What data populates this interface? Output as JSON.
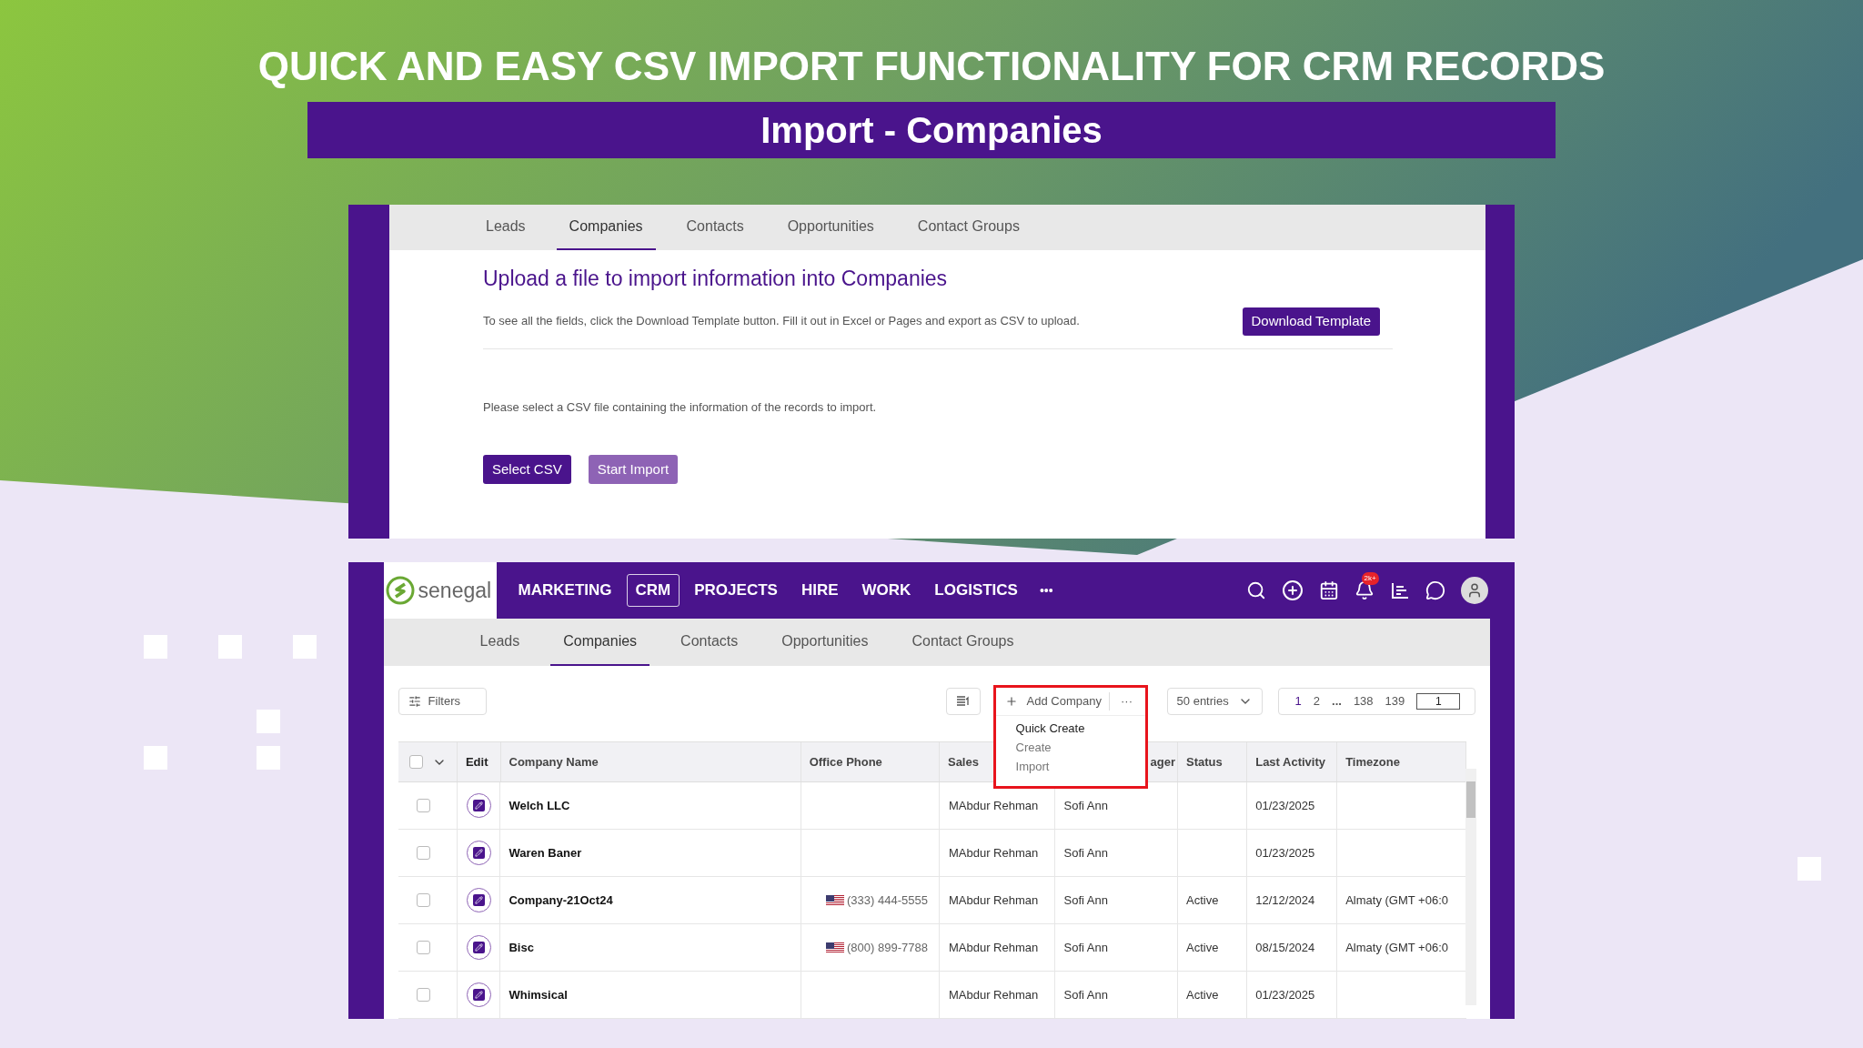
{
  "headline": "QUICK AND EASY CSV IMPORT FUNCTIONALITY FOR CRM RECORDS",
  "banner_title": "Import - Companies",
  "import_panel": {
    "tabs": [
      {
        "label": "Leads",
        "selected": false
      },
      {
        "label": "Companies",
        "selected": true
      },
      {
        "label": "Contacts",
        "selected": false
      },
      {
        "label": "Opportunities",
        "selected": false
      },
      {
        "label": "Contact Groups",
        "selected": false
      }
    ],
    "title": "Upload a file to import information into Companies",
    "instructions": "To see all the fields, click the Download Template button. Fill it out in Excel or Pages and export as CSV to upload.",
    "download_button": "Download Template",
    "select_prompt": "Please select a CSV file containing the information of the records to import.",
    "buttons": [
      {
        "label": "Select CSV",
        "disabled": false
      },
      {
        "label": "Start Import",
        "disabled": true
      }
    ]
  },
  "crm": {
    "logo_text": "senegal",
    "nav": [
      {
        "label": "MARKETING",
        "selected": false
      },
      {
        "label": "CRM",
        "selected": true
      },
      {
        "label": "PROJECTS",
        "selected": false
      },
      {
        "label": "HIRE",
        "selected": false
      },
      {
        "label": "WORK",
        "selected": false
      },
      {
        "label": "LOGISTICS",
        "selected": false
      }
    ],
    "nav_more": "•••",
    "notification_badge": "2k+",
    "tabs": [
      {
        "label": "Leads",
        "selected": false
      },
      {
        "label": "Companies",
        "selected": true
      },
      {
        "label": "Contacts",
        "selected": false
      },
      {
        "label": "Opportunities",
        "selected": false
      },
      {
        "label": "Contact Groups",
        "selected": false
      }
    ],
    "toolbar": {
      "filters": "Filters",
      "add_company": "Add Company",
      "more": "···",
      "entries": "50 entries",
      "pages": [
        {
          "label": "1",
          "selected": true
        },
        {
          "label": "2",
          "selected": false
        }
      ],
      "ellipsis": "...",
      "last_pages": [
        "138",
        "139"
      ],
      "page_input": "1"
    },
    "menu": [
      {
        "label": "Quick Create",
        "highlighted": true
      },
      {
        "label": "Create",
        "highlighted": false
      },
      {
        "label": "Import",
        "highlighted": false
      }
    ],
    "table": {
      "select_all_checked": false,
      "columns": [
        "Edit",
        "Company Name",
        "Office Phone",
        "Sales",
        "ager",
        "Status",
        "Last Activity",
        "Timezone"
      ],
      "rows": [
        {
          "checked": false,
          "company": "Welch LLC",
          "phone": "",
          "sales": "MAbdur Rehman",
          "manager": "Sofi Ann",
          "status": "",
          "last_activity": "01/23/2025",
          "timezone": ""
        },
        {
          "checked": false,
          "company": "Waren Baner",
          "phone": "",
          "sales": "MAbdur Rehman",
          "manager": "Sofi Ann",
          "status": "",
          "last_activity": "01/23/2025",
          "timezone": ""
        },
        {
          "checked": false,
          "company": "Company-21Oct24",
          "phone": "(333) 444-5555",
          "sales": "MAbdur Rehman",
          "manager": "Sofi Ann",
          "status": "Active",
          "last_activity": "12/12/2024",
          "timezone": "Almaty (GMT +06:0"
        },
        {
          "checked": false,
          "company": "Bisc",
          "phone": "(800) 899-7788",
          "sales": "MAbdur Rehman",
          "manager": "Sofi Ann",
          "status": "Active",
          "last_activity": "08/15/2024",
          "timezone": "Almaty (GMT +06:0"
        },
        {
          "checked": false,
          "company": "Whimsical",
          "phone": "",
          "sales": "MAbdur Rehman",
          "manager": "Sofi Ann",
          "status": "Active",
          "last_activity": "01/23/2025",
          "timezone": ""
        }
      ]
    }
  }
}
